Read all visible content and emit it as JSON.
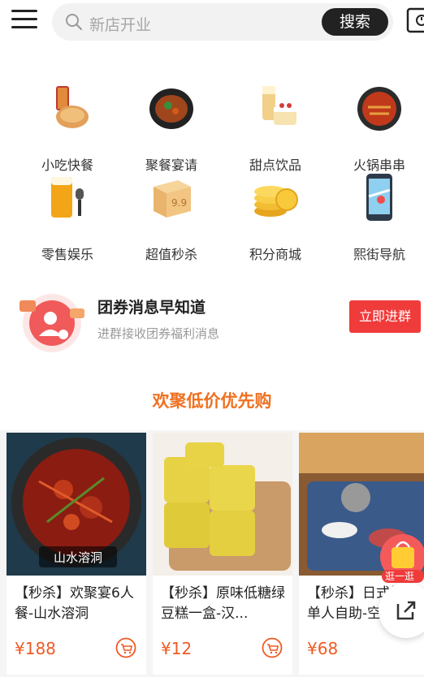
{
  "search": {
    "placeholder": "新店开业",
    "button_label": "搜索"
  },
  "categories": [
    {
      "label": "小吃快餐",
      "icon": "snack-icon"
    },
    {
      "label": "聚餐宴请",
      "icon": "feast-icon"
    },
    {
      "label": "甜点饮品",
      "icon": "dessert-icon"
    },
    {
      "label": "火锅串串",
      "icon": "hotpot-icon"
    },
    {
      "label": "零售娱乐",
      "icon": "beer-mic-icon"
    },
    {
      "label": "超值秒杀",
      "icon": "box-icon"
    },
    {
      "label": "积分商城",
      "icon": "coin-icon"
    },
    {
      "label": "熙街导航",
      "icon": "map-phone-icon"
    }
  ],
  "banner": {
    "title": "团券消息早知道",
    "subtitle": "进群接收团券福利消息",
    "button_label": "立即进群"
  },
  "section_title": "欢聚低价优先购",
  "products": [
    {
      "title": "【秒杀】欢聚宴6人餐-山水溶洞",
      "price": "¥188",
      "image_caption": "山水溶洞"
    },
    {
      "title": "【秒杀】原味低糖绿豆糕一盒-汉...",
      "price": "¥12"
    },
    {
      "title": "【秒杀】日式烧肉单人自助-空",
      "price": "¥68"
    }
  ],
  "float_action": {
    "label": "逛一逛"
  },
  "colors": {
    "accent": "#f07020",
    "price": "#f05a24",
    "join_button": "#f03b3b",
    "search_button": "#222222"
  }
}
